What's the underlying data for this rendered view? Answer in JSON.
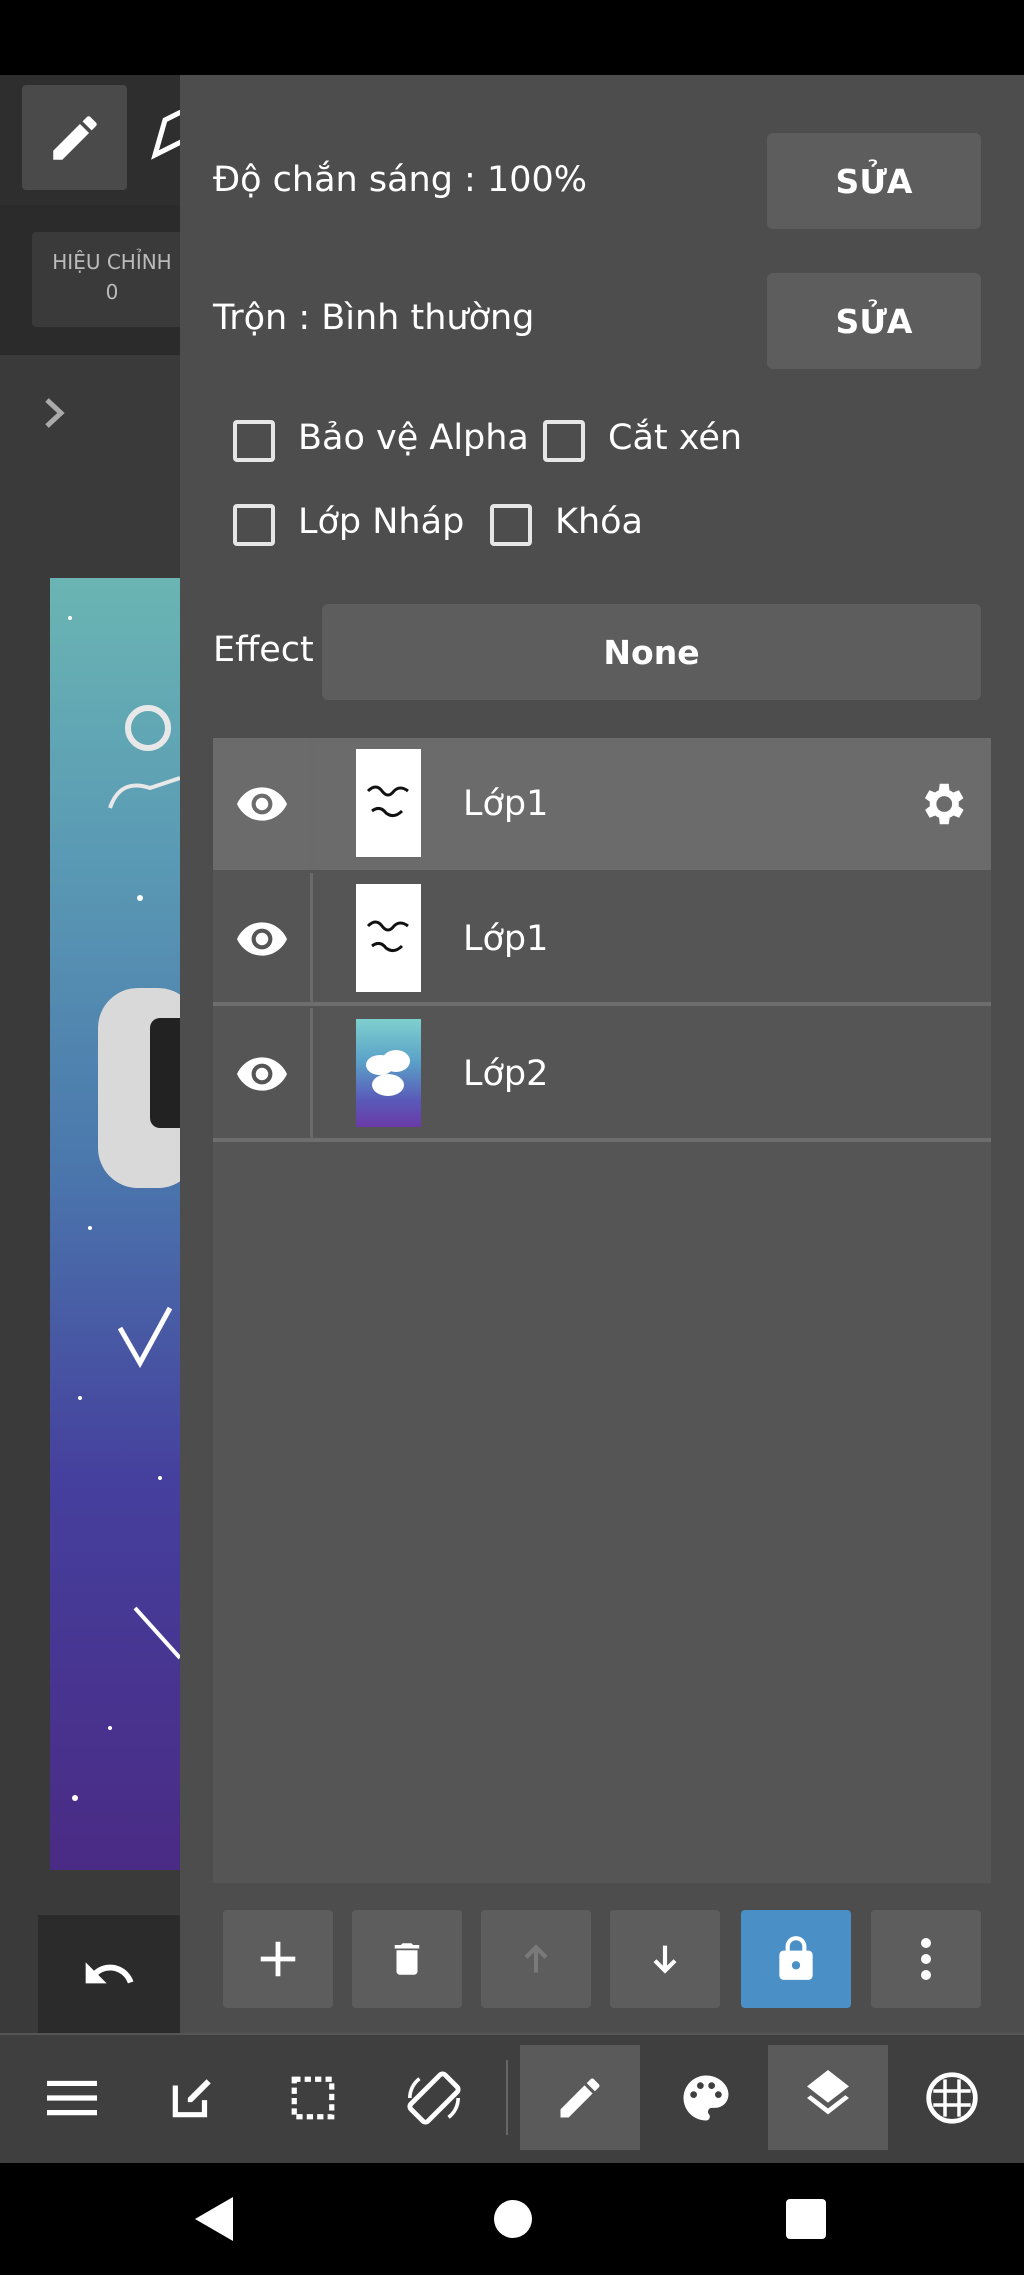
{
  "left_toolbar": {
    "adjust_label": "HIỆU CHỈNH",
    "adjust_value": "0"
  },
  "panel": {
    "opacity_label": "Độ chắn sáng : 100%",
    "opacity_edit": "SỬA",
    "blend_label": "Trộn : Bình thường",
    "blend_edit": "SỬA",
    "checkboxes": [
      {
        "label": "Bảo vệ Alpha",
        "checked": false
      },
      {
        "label": "Cắt xén",
        "checked": false
      },
      {
        "label": "Lớp Nháp",
        "checked": false
      },
      {
        "label": "Khóa",
        "checked": false
      }
    ],
    "effect_label": "Effect",
    "effect_value": "None"
  },
  "layers": [
    {
      "name": "Lớp1",
      "selected": true,
      "visible": true
    },
    {
      "name": "Lớp1",
      "selected": false,
      "visible": true
    },
    {
      "name": "Lớp2",
      "selected": false,
      "visible": true
    }
  ],
  "layer_actions": [
    "add-layer",
    "delete-layer",
    "move-up",
    "move-down",
    "lock-layer",
    "more-options"
  ],
  "bottom_toolbar": [
    "menu",
    "edit",
    "selection",
    "rotate",
    "pen",
    "palette",
    "layers",
    "grid"
  ],
  "colors": {
    "panel_bg": "#4d4d4d",
    "accent": "#4a90c6",
    "selected_row": "#6b6b6b"
  }
}
